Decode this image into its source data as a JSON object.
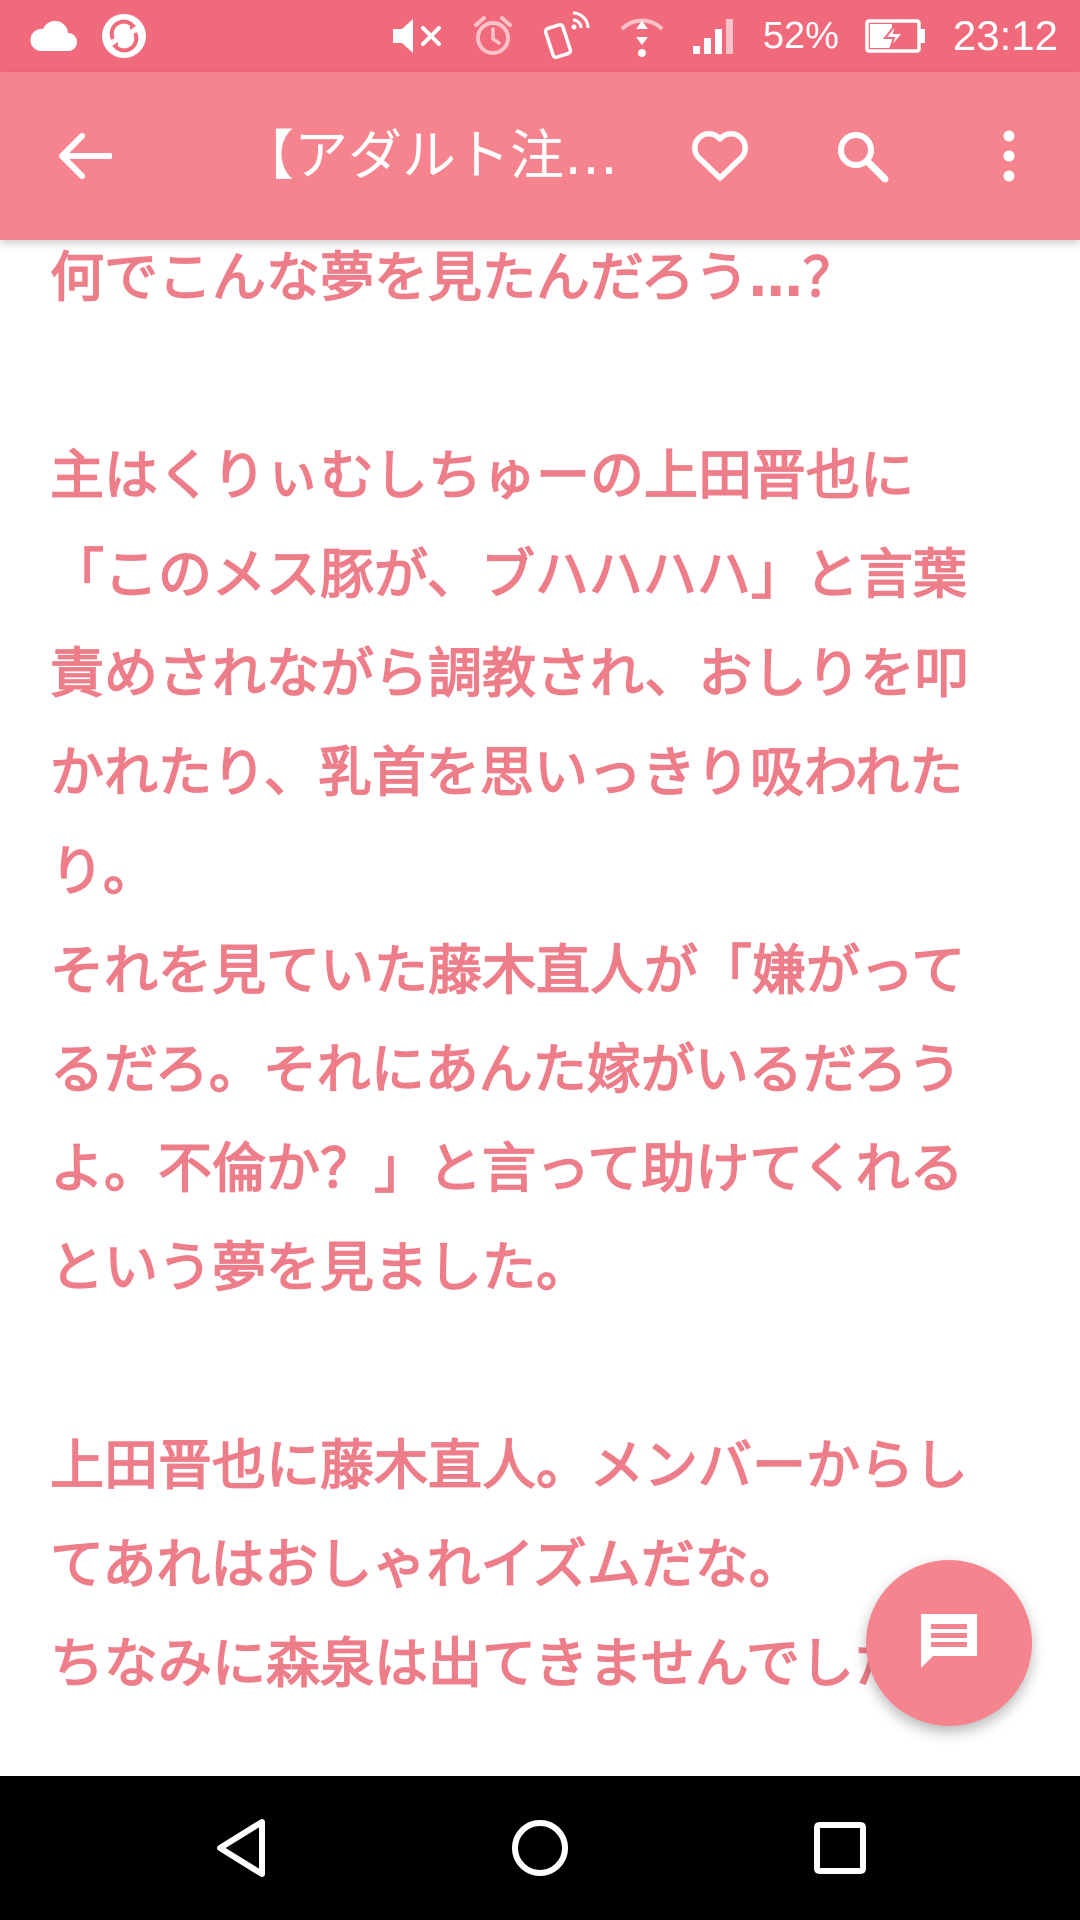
{
  "status_bar": {
    "battery_percent": "52%",
    "time": "23:12",
    "icons": [
      "cloud-icon",
      "app-sync-icon",
      "mute-icon",
      "alarm-icon",
      "nfc-phone-icon",
      "wifi-icon",
      "signal-icon",
      "battery-charging-icon"
    ]
  },
  "app_bar": {
    "title": "【アダルト注意】上田晋也",
    "icons": [
      "back-arrow-icon",
      "heart-icon",
      "search-icon",
      "more-vert-icon"
    ]
  },
  "article": {
    "text": "何でこんな夢を見たんだろう…？\n\n主はくりぃむしちゅーの上田晋也に「このメス豚が、ブハハハハ」と言葉責めされながら調教され、おしりを叩かれたり、乳首を思いっきり吸われたり。\nそれを見ていた藤木直人が「嫌がってるだろ。それにあんた嫁がいるだろうよ。不倫か？」と言って助けてくれるという夢を見ました。\n\n上田晋也に藤木直人。メンバーからしてあれはおしゃれイズムだな。\nちなみに森泉は出てきませんでした。"
  },
  "fab": {
    "icon": "comment-icon"
  },
  "nav_bar": {
    "icons": [
      "nav-back-icon",
      "nav-home-icon",
      "nav-recents-icon"
    ]
  },
  "colors": {
    "status_bar": "#f06a7c",
    "app_bar": "#f6848f",
    "text": "#ee7d8a",
    "fab": "#f6848f"
  }
}
